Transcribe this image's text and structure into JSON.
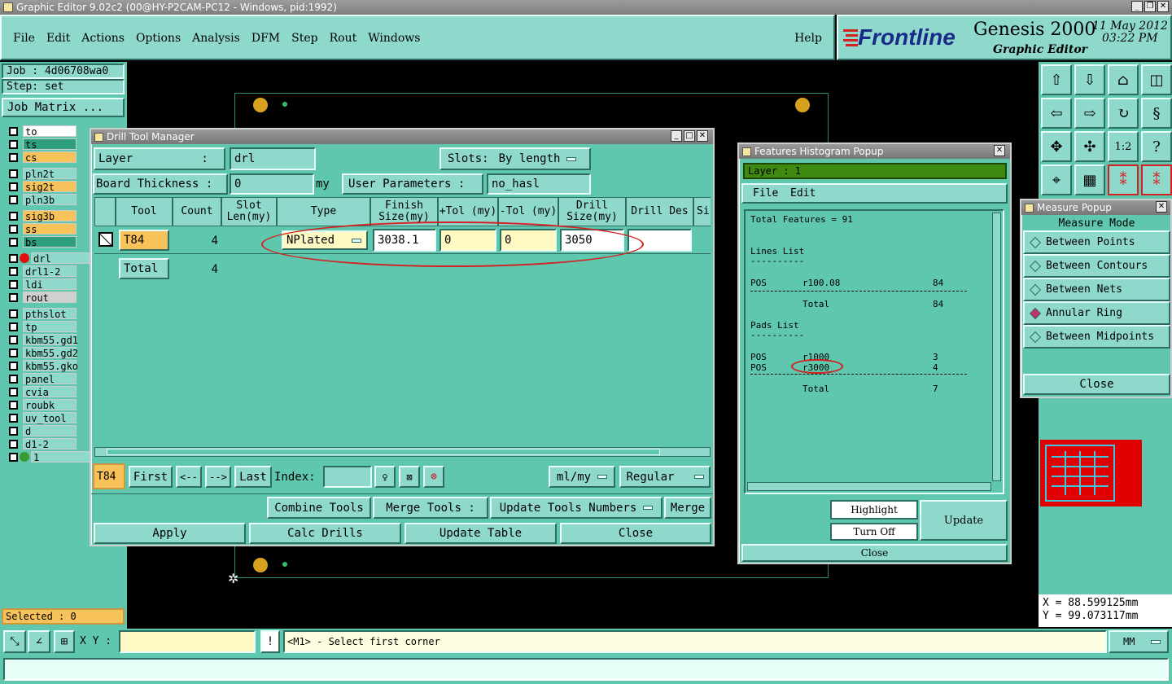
{
  "window": {
    "title": "Graphic Editor 9.02c2 (00@HY-P2CAM-PC12 - Windows, pid:1992)"
  },
  "menu": [
    "File",
    "Edit",
    "Actions",
    "Options",
    "Analysis",
    "DFM",
    "Step",
    "Rout",
    "Windows"
  ],
  "help": "Help",
  "brand": {
    "logo": "Frontline",
    "product": "Genesis 2000",
    "subtitle": "Graphic Editor",
    "date": "11 May 2012",
    "time": "03:22 PM"
  },
  "job": {
    "job": "Job : 4d06708wa0",
    "step": "Step: set",
    "matrix": "Job Matrix ..."
  },
  "layers": [
    {
      "name": "to",
      "color": "#ffffff"
    },
    {
      "name": "ts",
      "color": "#2e9e7e"
    },
    {
      "name": "cs",
      "color": "#f7c25a"
    },
    {
      "name": "pln2t",
      "color": "#8fd9cc"
    },
    {
      "name": "sig2t",
      "color": "#f7c25a"
    },
    {
      "name": "pln3b",
      "color": "#8fd9cc"
    },
    {
      "name": "sig3b",
      "color": "#f7c25a"
    },
    {
      "name": "ss",
      "color": "#f7c25a"
    },
    {
      "name": "bs",
      "color": "#2e9e7e"
    },
    {
      "name": "drl",
      "color": "#8fd9cc"
    },
    {
      "name": "drl1-2",
      "color": "#8fd9cc"
    },
    {
      "name": "ldi",
      "color": "#8fd9cc"
    },
    {
      "name": "rout",
      "color": "#d0d0d0"
    },
    {
      "name": "pthslot",
      "color": "#8fd9cc"
    },
    {
      "name": "tp",
      "color": "#8fd9cc"
    },
    {
      "name": "kbm55.gd1",
      "color": "#8fd9cc"
    },
    {
      "name": "kbm55.gd2",
      "color": "#8fd9cc"
    },
    {
      "name": "kbm55.gko",
      "color": "#8fd9cc"
    },
    {
      "name": "panel",
      "color": "#8fd9cc"
    },
    {
      "name": "cvia",
      "color": "#8fd9cc"
    },
    {
      "name": "roubk",
      "color": "#8fd9cc"
    },
    {
      "name": "uv_tool",
      "color": "#8fd9cc"
    },
    {
      "name": "d",
      "color": "#8fd9cc"
    },
    {
      "name": "d1-2",
      "color": "#8fd9cc"
    },
    {
      "name": "1",
      "color": "#8fd9cc"
    }
  ],
  "selected": "Selected : 0",
  "dtm": {
    "title": "Drill Tool Manager",
    "layer_label": "Layer          :",
    "layer_value": "drl",
    "slots_label": "Slots:",
    "slots_value": "By length",
    "thick_label": "Board Thickness :",
    "thick_value": "0",
    "thick_unit": "my",
    "user_params": "User Parameters :",
    "user_params_value": "no_hasl",
    "headers": {
      "tool": "Tool",
      "count": "Count",
      "slot": "Slot Len(my)",
      "type": "Type",
      "finish": "Finish Size(my)",
      "ptol": "+Tol (my)",
      "mtol": "-Tol (my)",
      "drill": "Drill Size(my)",
      "des": "Drill Des",
      "si": "Si"
    },
    "row": {
      "tool": "T84",
      "count": "4",
      "type": "NPlated",
      "finish": "3038.1",
      "ptol": "0",
      "mtol": "0",
      "drill": "3050"
    },
    "total_label": "Total",
    "total_count": "4",
    "nav": {
      "cur": "T84",
      "first": "First",
      "prev": "<--",
      "next": "-->",
      "last": "Last",
      "index": "Index:",
      "units": "ml/my",
      "mode": "Regular"
    },
    "combine": "Combine Tools",
    "merge_label": "Merge Tools :",
    "update_nums": "Update Tools Numbers",
    "merge": "Merge",
    "apply": "Apply",
    "calc": "Calc Drills",
    "update_table": "Update Table",
    "close": "Close"
  },
  "hist": {
    "title": "Features Histogram Popup",
    "layer": "Layer :  1",
    "menu": [
      "File",
      "Edit"
    ],
    "total": "Total Features = 91",
    "lines_list": "Lines List",
    "sep": "----------",
    "line_row": {
      "pos": "POS",
      "sym": "r100.08",
      "n": "84"
    },
    "total_label": "Total",
    "lines_total": "84",
    "pads_list": "Pads List",
    "pad_rows": [
      {
        "pos": "POS",
        "sym": "r1000",
        "n": "3"
      },
      {
        "pos": "POS",
        "sym": "r3000",
        "n": "4"
      }
    ],
    "pads_total": "7",
    "highlight": "Highlight",
    "turn_off": "Turn Off",
    "update": "Update",
    "close": "Close"
  },
  "measure": {
    "title": "Measure Popup",
    "mode": "Measure Mode",
    "options": [
      "Between Points",
      "Between Contours",
      "Between Nets",
      "Annular Ring",
      "Between Midpoints"
    ],
    "selected_index": 3,
    "close": "Close"
  },
  "coords": {
    "x": "X = 88.599125mm",
    "y": "Y = 99.073117mm"
  },
  "status": {
    "xy_label": "X Y :",
    "message": "<M1> - Select first corner",
    "unit": "MM"
  }
}
